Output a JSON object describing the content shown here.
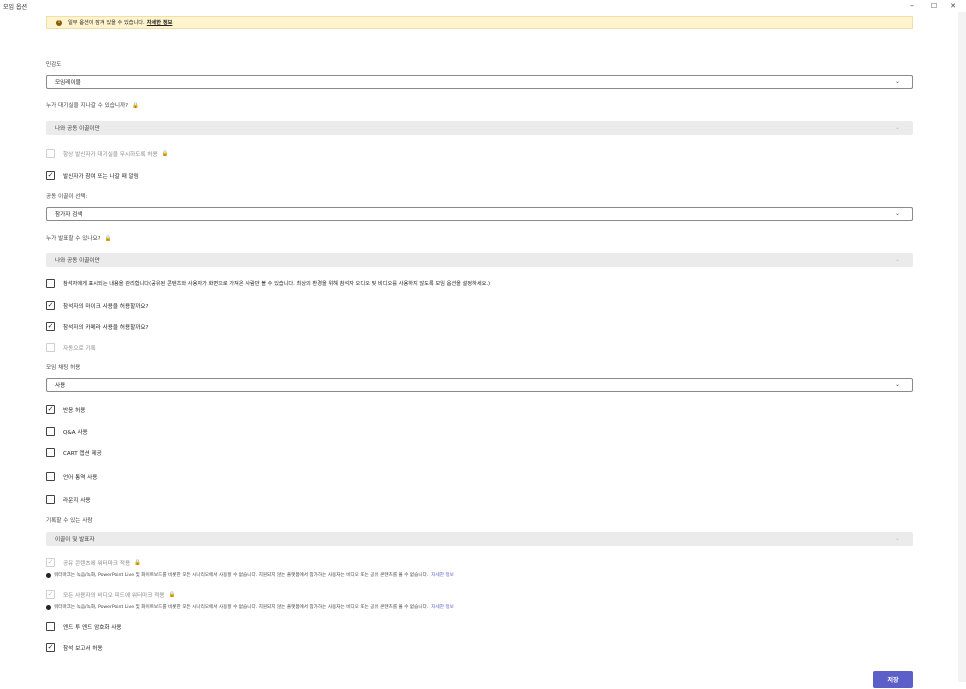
{
  "window": {
    "title": "모임 옵션",
    "minimize": "–",
    "maximize": "☐",
    "close": "✕"
  },
  "banner": {
    "text": "일부 옵션이 잠겨 있을 수 있습니다.",
    "link": "자세한 정보"
  },
  "sensitivity": {
    "label": "민감도",
    "value": "모임레이블"
  },
  "lobby_bypass": {
    "label": "누가 대기실을 지나갈 수 있습니까?",
    "value": "나와 공동 이끌이만"
  },
  "always_bypass": {
    "label": "항상 발신자가 대기실을 무시하도록 허용",
    "checked": false,
    "disabled": true
  },
  "announce": {
    "label": "발신자가 참여 또는 나갈 때 알림",
    "checked": true
  },
  "coorganizer": {
    "label": "공동 이끌이 선택:",
    "value": "참가자 검색"
  },
  "presenters": {
    "label": "누가 발표할 수 있나요?",
    "value": "나와 공동 이끌이만"
  },
  "manage_content": {
    "label": "참석자에게 표시되는 내용을 관리합니다(공유된 콘텐츠와 사용자가 화면으로 가져온 사람만 볼 수 있습니다. 최상의 환경을 위해 참석자 오디오 및 비디오를 사용하지 않도록 모임 옵션을 설정하세요.)",
    "checked": false
  },
  "allow_mic": {
    "label": "참석자의 마이크 사용을 허용할까요?",
    "checked": true
  },
  "allow_camera": {
    "label": "참석자의 카메라 사용을 허용할까요?",
    "checked": true
  },
  "auto_record": {
    "label": "자동으로 기록",
    "checked": false,
    "disabled": true
  },
  "chat": {
    "label": "모임 채팅 허용",
    "value": "사용"
  },
  "reactions": {
    "label": "반응 허용",
    "checked": true
  },
  "qa": {
    "label": "Q&A 사용",
    "checked": false
  },
  "cart": {
    "label": "CART 캡션 제공",
    "checked": false
  },
  "interpretation": {
    "label": "언어 통역 사용",
    "checked": false
  },
  "green_room": {
    "label": "라운지 사용",
    "checked": false
  },
  "recorders": {
    "label": "기록할 수 있는 사람",
    "value": "이끌이 및 발표자"
  },
  "watermark_content": {
    "label": "공유 콘텐츠에 워터마크 적용",
    "checked": true,
    "disabled": true,
    "note": "워터마크는 녹음/녹화, PowerPoint Live 및 화이트보드를 비롯한 모든 시나리오에서 사용할 수 없습니다. 지원되지 않는 플랫폼에서 참가하는 사용자는 비디오 또는 공유 콘텐츠를 볼 수 없습니다.",
    "more": "자세한 정보"
  },
  "watermark_video": {
    "label": "모든 사용자의 비디오 피드에 워터마크 적용",
    "checked": true,
    "disabled": true,
    "note": "워터마크는 녹음/녹화, PowerPoint Live 및 화이트보드를 비롯한 모든 시나리오에서 사용할 수 없습니다. 지원되지 않는 플랫폼에서 참가하는 사용자는 비디오 또는 공유 콘텐츠를 볼 수 없습니다.",
    "more": "자세한 정보"
  },
  "e2ee": {
    "label": "엔드 투 엔드 암호화 사용",
    "checked": false
  },
  "attendance": {
    "label": "참석 보고서 허용",
    "checked": true
  },
  "icons": {
    "check": "✓",
    "chevron": "⌄",
    "lock": "🔒",
    "warning": "!"
  },
  "save_label": "저장",
  "colors": {
    "accent": "#5b5fc7",
    "banner_bg": "#fff4ce",
    "disabled_bg": "#ebebeb"
  }
}
